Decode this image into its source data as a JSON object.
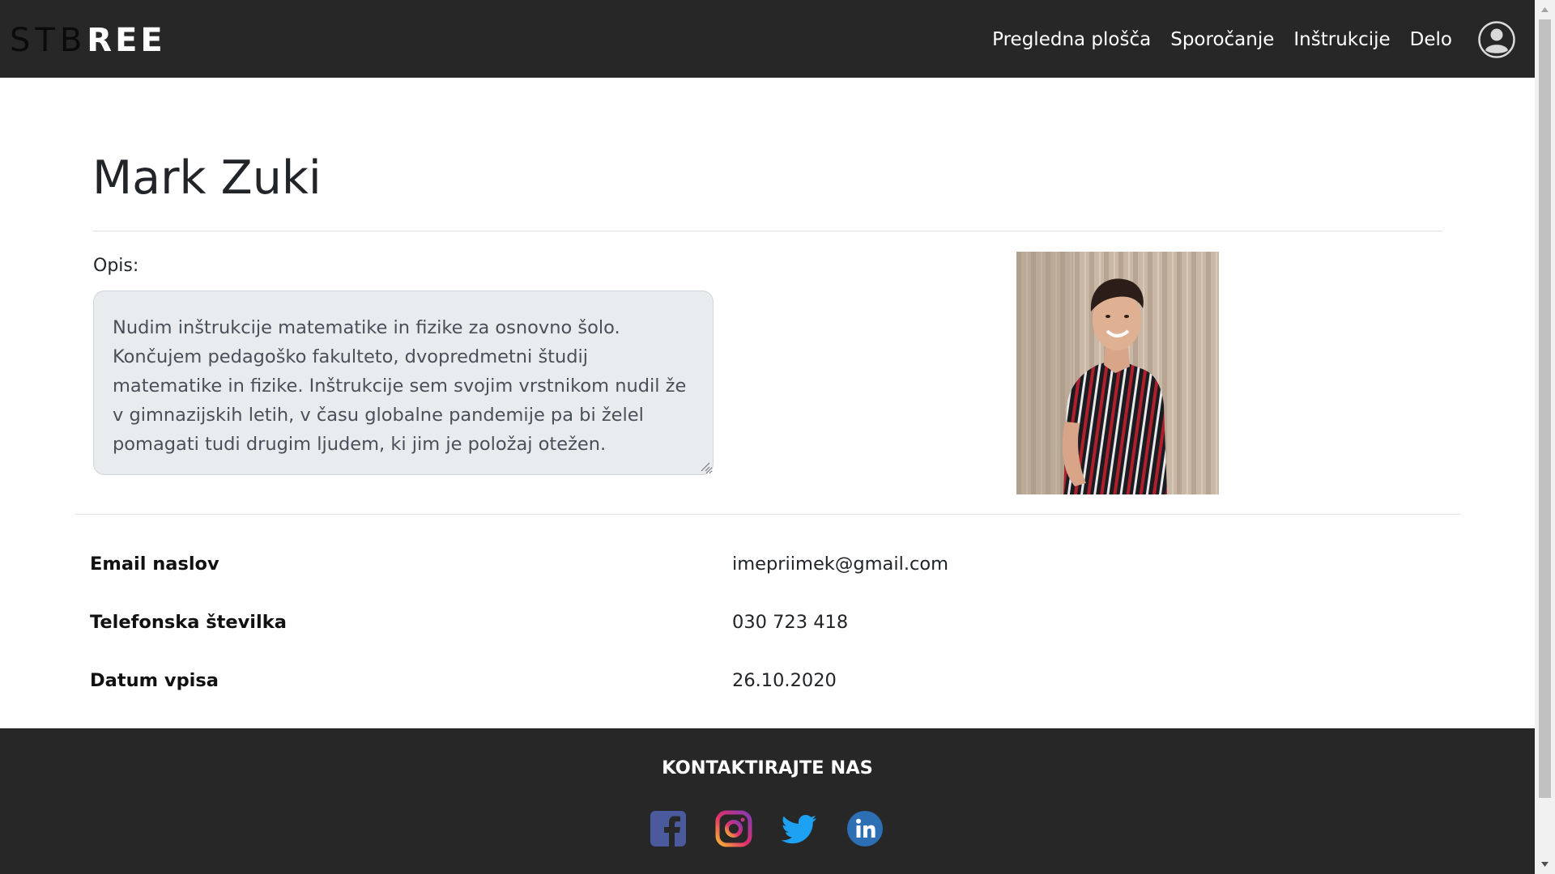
{
  "brand": {
    "logo_dark": "STB",
    "logo_light": "REE"
  },
  "nav": {
    "items": [
      {
        "label": "Pregledna plošča"
      },
      {
        "label": "Sporočanje"
      },
      {
        "label": "Inštrukcije"
      },
      {
        "label": "Delo"
      }
    ],
    "account_icon": "user-circle-icon"
  },
  "profile": {
    "name": "Mark Zuki",
    "description_label": "Opis:",
    "description": "Nudim inštrukcije matematike in fizike za osnovno šolo. Končujem pedagoško fakulteto, dvopredmetni študij matematike in fizike. Inštrukcije sem svojim vrstnikom nudil že v gimnazijskih letih, v času globalne pandemije pa bi želel pomagati tudi drugim ljudem, ki jim je položaj otežen.",
    "details": [
      {
        "label": "Email naslov",
        "value": "imepriimek@gmail.com"
      },
      {
        "label": "Telefonska številka",
        "value": "030 723 418"
      },
      {
        "label": "Datum vpisa",
        "value": "26.10.2020"
      }
    ]
  },
  "footer": {
    "title": "KONTAKTIRAJTE NAS",
    "social": [
      {
        "icon": "facebook-icon",
        "color": "#4a5a9c"
      },
      {
        "icon": "instagram-icon",
        "color": "#c13584"
      },
      {
        "icon": "twitter-icon",
        "color": "#1da1f2"
      },
      {
        "icon": "linkedin-icon",
        "color": "#2c6fb5"
      }
    ]
  },
  "colors": {
    "navbar": "#272727",
    "footer": "#272727",
    "textarea_bg": "#e9ecef"
  }
}
